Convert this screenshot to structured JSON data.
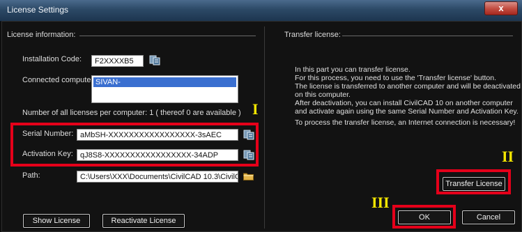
{
  "window": {
    "title": "License Settings",
    "close_glyph": "x"
  },
  "license_info": {
    "group_label": "License information:",
    "installation_code_label": "Installation Code:",
    "installation_code_value": "F2XXXXB5",
    "connected_computers_label": "Connected computers:",
    "connected_computers": [
      "SIVAN-"
    ],
    "licenses_count_text": "Number of all licenses per computer:  1  ( thereof   0   are available )",
    "serial_number_label": "Serial Number:",
    "serial_number_value": "aMbSH-XXXXXXXXXXXXXXXXX-3sAEC",
    "activation_key_label": "Activation Key:",
    "activation_key_value": "qJ8S8-XXXXXXXXXXXXXXXXX-34ADP",
    "path_label": "Path:",
    "path_value": "C:\\Users\\XXX\\Documents\\CivilCAD 10.3\\CivilCAD 10"
  },
  "transfer": {
    "group_label": "Transfer license:",
    "description_lines": [
      "In this part you can transfer license.",
      "For this process, you need to use the 'Transfer license' button.",
      "The license is transferred to another computer and will be deactivated",
      "on this computer.",
      "After deactivation, you can install CivilCAD 10 on another computer",
      "and activate again using the same Serial Number and Activation Key."
    ],
    "internet_note": "To process the transfer license, an Internet connection is necessary!",
    "transfer_button": "Transfer License"
  },
  "buttons": {
    "show_license": "Show License",
    "reactivate_license": "Reactivate License",
    "ok": "OK",
    "cancel": "Cancel"
  },
  "annotations": {
    "marker_1": "I",
    "marker_2": "II",
    "marker_3": "III",
    "highlight_color": "#e5001a",
    "marker_color": "#f5e600"
  },
  "icons": [
    "copy-icon",
    "copy-icon",
    "copy-icon",
    "folder-icon",
    "close-icon"
  ]
}
